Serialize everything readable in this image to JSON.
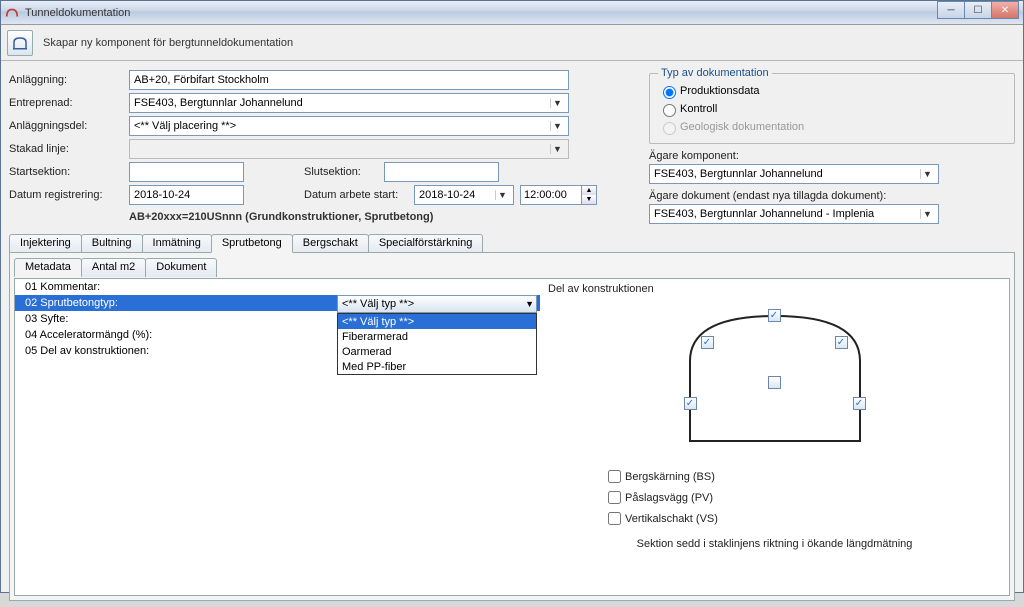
{
  "window": {
    "title": "Tunneldokumentation"
  },
  "toolbar": {
    "subtitle": "Skapar ny komponent för bergtunneldokumentation"
  },
  "form": {
    "anlaggning_label": "Anläggning:",
    "anlaggning_value": "AB+20, Förbifart Stockholm",
    "entreprenad_label": "Entreprenad:",
    "entreprenad_value": "FSE403, Bergtunnlar Johannelund",
    "anlaggningsdel_label": "Anläggningsdel:",
    "anlaggningsdel_value": "<** Välj placering **>",
    "stakadlinje_label": "Stakad linje:",
    "stakadlinje_value": "",
    "startsektion_label": "Startsektion:",
    "slutsektion_label": "Slutsektion:",
    "datumreg_label": "Datum registrering:",
    "datumreg_value": "2018-10-24",
    "datumarb_label": "Datum arbete start:",
    "datumarb_value": "2018-10-24",
    "time_value": "12:00:00",
    "summary": "AB+20xxx=210USnnn  (Grundkonstruktioner, Sprutbetong)"
  },
  "doc_type": {
    "legend": "Typ av dokumentation",
    "opt1": "Produktionsdata",
    "opt2": "Kontroll",
    "opt3": "Geologisk dokumentation"
  },
  "owner": {
    "komponent_label": "Ägare komponent:",
    "komponent_value": "FSE403, Bergtunnlar Johannelund",
    "dokument_label": "Ägare dokument (endast nya tillagda dokument):",
    "dokument_value": "FSE403, Bergtunnlar Johannelund - Implenia"
  },
  "tabs": {
    "t1": "Injektering",
    "t2": "Bultning",
    "t3": "Inmätning",
    "t4": "Sprutbetong",
    "t5": "Bergschakt",
    "t6": "Specialförstärkning"
  },
  "subtabs": {
    "s1": "Metadata",
    "s2": "Antal m2",
    "s3": "Dokument"
  },
  "metadata": {
    "row1": "01 Kommentar:",
    "row2": "02 Sprutbetongtyp:",
    "row3": "03 Syfte:",
    "row4": "04 Acceleratormängd (%):",
    "row5": "05 Del av konstruktionen:",
    "dd_current": "<** Välj typ **>",
    "dd_options": {
      "o1": "<** Välj typ **>",
      "o2": "Fiberarmerad",
      "o3": "Oarmerad",
      "o4": "Med PP-fiber"
    }
  },
  "konstruktion": {
    "title": "Del av konstruktionen",
    "c1": "Bergskärning (BS)",
    "c2": "Påslagsvägg (PV)",
    "c3": "Vertikalschakt (VS)",
    "note": "Sektion sedd i staklinjens riktning i ökande längdmätning"
  }
}
